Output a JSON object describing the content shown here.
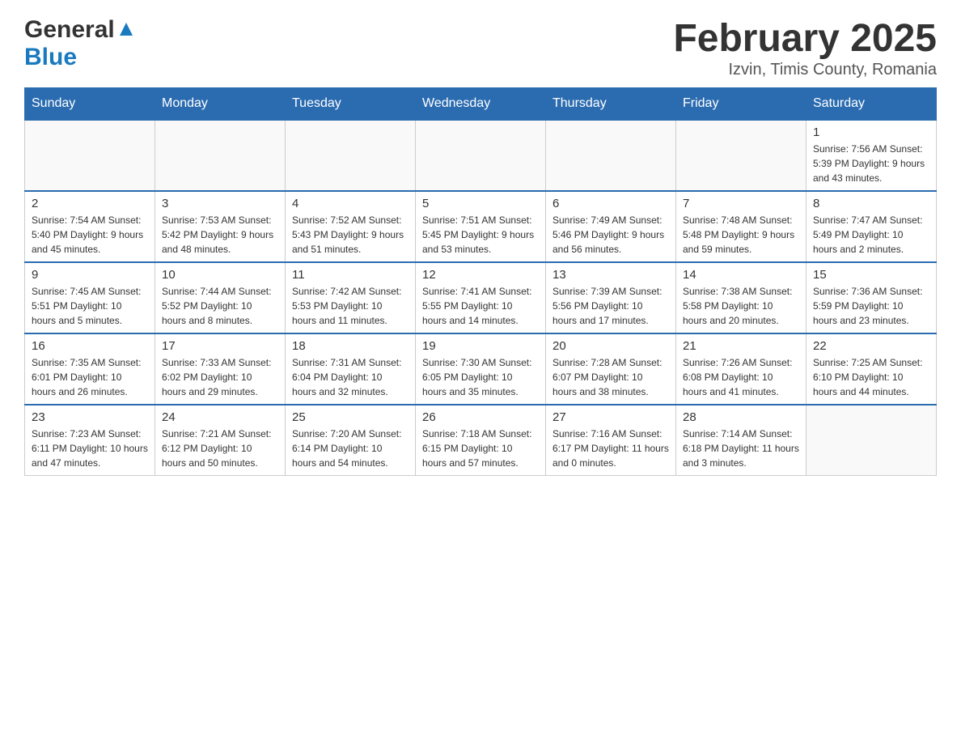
{
  "header": {
    "logo_general": "General",
    "logo_blue": "Blue",
    "month_title": "February 2025",
    "location": "Izvin, Timis County, Romania"
  },
  "weekdays": [
    "Sunday",
    "Monday",
    "Tuesday",
    "Wednesday",
    "Thursday",
    "Friday",
    "Saturday"
  ],
  "weeks": [
    [
      {
        "day": "",
        "info": ""
      },
      {
        "day": "",
        "info": ""
      },
      {
        "day": "",
        "info": ""
      },
      {
        "day": "",
        "info": ""
      },
      {
        "day": "",
        "info": ""
      },
      {
        "day": "",
        "info": ""
      },
      {
        "day": "1",
        "info": "Sunrise: 7:56 AM\nSunset: 5:39 PM\nDaylight: 9 hours\nand 43 minutes."
      }
    ],
    [
      {
        "day": "2",
        "info": "Sunrise: 7:54 AM\nSunset: 5:40 PM\nDaylight: 9 hours\nand 45 minutes."
      },
      {
        "day": "3",
        "info": "Sunrise: 7:53 AM\nSunset: 5:42 PM\nDaylight: 9 hours\nand 48 minutes."
      },
      {
        "day": "4",
        "info": "Sunrise: 7:52 AM\nSunset: 5:43 PM\nDaylight: 9 hours\nand 51 minutes."
      },
      {
        "day": "5",
        "info": "Sunrise: 7:51 AM\nSunset: 5:45 PM\nDaylight: 9 hours\nand 53 minutes."
      },
      {
        "day": "6",
        "info": "Sunrise: 7:49 AM\nSunset: 5:46 PM\nDaylight: 9 hours\nand 56 minutes."
      },
      {
        "day": "7",
        "info": "Sunrise: 7:48 AM\nSunset: 5:48 PM\nDaylight: 9 hours\nand 59 minutes."
      },
      {
        "day": "8",
        "info": "Sunrise: 7:47 AM\nSunset: 5:49 PM\nDaylight: 10 hours\nand 2 minutes."
      }
    ],
    [
      {
        "day": "9",
        "info": "Sunrise: 7:45 AM\nSunset: 5:51 PM\nDaylight: 10 hours\nand 5 minutes."
      },
      {
        "day": "10",
        "info": "Sunrise: 7:44 AM\nSunset: 5:52 PM\nDaylight: 10 hours\nand 8 minutes."
      },
      {
        "day": "11",
        "info": "Sunrise: 7:42 AM\nSunset: 5:53 PM\nDaylight: 10 hours\nand 11 minutes."
      },
      {
        "day": "12",
        "info": "Sunrise: 7:41 AM\nSunset: 5:55 PM\nDaylight: 10 hours\nand 14 minutes."
      },
      {
        "day": "13",
        "info": "Sunrise: 7:39 AM\nSunset: 5:56 PM\nDaylight: 10 hours\nand 17 minutes."
      },
      {
        "day": "14",
        "info": "Sunrise: 7:38 AM\nSunset: 5:58 PM\nDaylight: 10 hours\nand 20 minutes."
      },
      {
        "day": "15",
        "info": "Sunrise: 7:36 AM\nSunset: 5:59 PM\nDaylight: 10 hours\nand 23 minutes."
      }
    ],
    [
      {
        "day": "16",
        "info": "Sunrise: 7:35 AM\nSunset: 6:01 PM\nDaylight: 10 hours\nand 26 minutes."
      },
      {
        "day": "17",
        "info": "Sunrise: 7:33 AM\nSunset: 6:02 PM\nDaylight: 10 hours\nand 29 minutes."
      },
      {
        "day": "18",
        "info": "Sunrise: 7:31 AM\nSunset: 6:04 PM\nDaylight: 10 hours\nand 32 minutes."
      },
      {
        "day": "19",
        "info": "Sunrise: 7:30 AM\nSunset: 6:05 PM\nDaylight: 10 hours\nand 35 minutes."
      },
      {
        "day": "20",
        "info": "Sunrise: 7:28 AM\nSunset: 6:07 PM\nDaylight: 10 hours\nand 38 minutes."
      },
      {
        "day": "21",
        "info": "Sunrise: 7:26 AM\nSunset: 6:08 PM\nDaylight: 10 hours\nand 41 minutes."
      },
      {
        "day": "22",
        "info": "Sunrise: 7:25 AM\nSunset: 6:10 PM\nDaylight: 10 hours\nand 44 minutes."
      }
    ],
    [
      {
        "day": "23",
        "info": "Sunrise: 7:23 AM\nSunset: 6:11 PM\nDaylight: 10 hours\nand 47 minutes."
      },
      {
        "day": "24",
        "info": "Sunrise: 7:21 AM\nSunset: 6:12 PM\nDaylight: 10 hours\nand 50 minutes."
      },
      {
        "day": "25",
        "info": "Sunrise: 7:20 AM\nSunset: 6:14 PM\nDaylight: 10 hours\nand 54 minutes."
      },
      {
        "day": "26",
        "info": "Sunrise: 7:18 AM\nSunset: 6:15 PM\nDaylight: 10 hours\nand 57 minutes."
      },
      {
        "day": "27",
        "info": "Sunrise: 7:16 AM\nSunset: 6:17 PM\nDaylight: 11 hours\nand 0 minutes."
      },
      {
        "day": "28",
        "info": "Sunrise: 7:14 AM\nSunset: 6:18 PM\nDaylight: 11 hours\nand 3 minutes."
      },
      {
        "day": "",
        "info": ""
      }
    ]
  ]
}
